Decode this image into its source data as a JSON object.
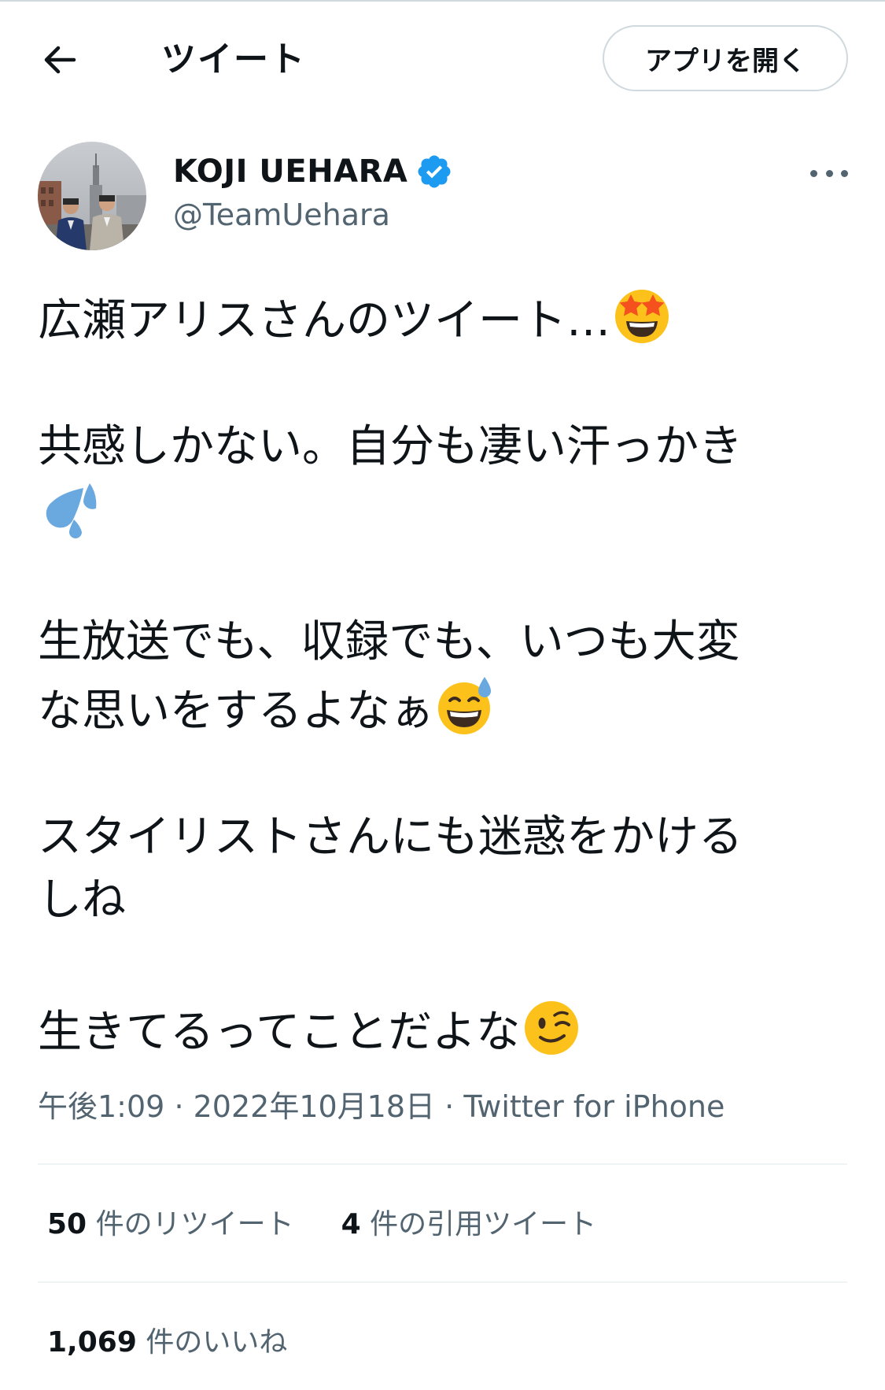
{
  "header": {
    "title": "ツイート",
    "back_icon": "arrow-left-icon",
    "open_app_label": "アプリを開く"
  },
  "author": {
    "display_name": "KOJI UEHARA",
    "handle": "@TeamUehara",
    "verified_icon": "verified-badge-icon",
    "more_icon": "more-horizontal-icon"
  },
  "tweet": {
    "lines": {
      "l1": "広瀬アリスさんのツイート…",
      "l2": "共感しかない。自分も凄い汗っかき",
      "l3": "生放送でも、収録でも、いつも大変",
      "l4": "な思いをするよなぁ",
      "l5": "スタイリストさんにも迷惑をかける",
      "l6": "しね",
      "l7": "生きてるってことだよな"
    },
    "emojis": {
      "e1": "star-struck-emoji",
      "e2": "sweat-droplets-emoji",
      "e3": "grinning-sweat-emoji",
      "e4": "winking-face-emoji"
    }
  },
  "meta": {
    "time": "午後1:09",
    "date": "2022年10月18日",
    "separator": "·",
    "source": "Twitter for iPhone"
  },
  "stats": {
    "retweets_count": "50",
    "retweets_label": "件のリツイート",
    "quotes_count": "4",
    "quotes_label": "件の引用ツイート",
    "likes_count": "1,069",
    "likes_label": "件のいいね"
  },
  "colors": {
    "text": "#0f1419",
    "secondary": "#536471",
    "verified": "#1d9bf0",
    "divider": "#eff3f4",
    "emoji_yellow": "#fcc21b",
    "emoji_sweat": "#6aa9e0"
  }
}
